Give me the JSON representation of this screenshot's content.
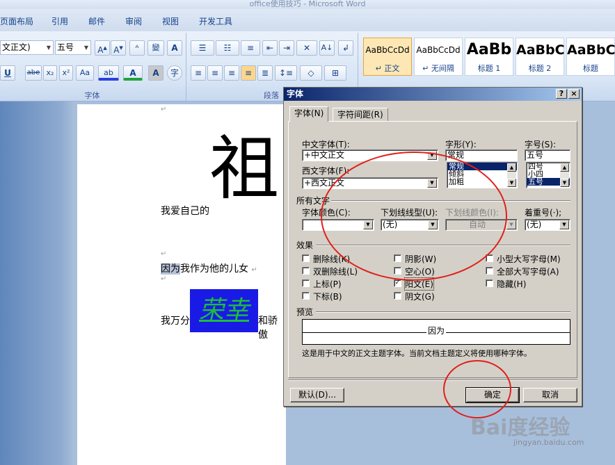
{
  "window": {
    "title": "office使用技巧 - Microsoft Word"
  },
  "ribbon": {
    "tabs": [
      "页面布局",
      "引用",
      "邮件",
      "审阅",
      "视图",
      "开发工具"
    ],
    "font_name": "文正文)",
    "font_size": "五号",
    "group_font": "字体",
    "group_paragraph": "段落",
    "styles": [
      {
        "sample": "AaBbCcDd",
        "caption": "↵ 正文"
      },
      {
        "sample": "AaBbCcDd",
        "caption": "↵ 无间隔"
      },
      {
        "sample": "AaBb",
        "caption": "标题 1"
      },
      {
        "sample": "AaBbC",
        "caption": "标题 2"
      },
      {
        "sample": "AaBbC",
        "caption": "标题"
      }
    ]
  },
  "document": {
    "big_char": "祖",
    "line1": "我爱自己的",
    "line2_highlight": "因为",
    "line2_rest": "我作为他的儿女",
    "line3_start": "我万分",
    "art_text": "荣幸",
    "line3_end": "和骄傲"
  },
  "dialog": {
    "title": "字体",
    "help": "?",
    "close": "×",
    "tabs": [
      "字体(N)",
      "字符间距(R)"
    ],
    "labels": {
      "cn_font": "中文字体(T):",
      "west_font": "西文字体(F):",
      "style": "字形(Y):",
      "size": "字号(S):",
      "all_text": "所有文字",
      "font_color": "字体颜色(C):",
      "underline": "下划线线型(U):",
      "underline_color": "下划线颜色(I):",
      "emphasis": "着重号(·);",
      "effects": "效果",
      "preview": "预览"
    },
    "values": {
      "cn_font": "+中文正文",
      "west_font": "+西文正文",
      "style": "常规",
      "size": "五号",
      "underline": "(无)",
      "underline_color": "自动",
      "emphasis": "(无)"
    },
    "style_list": [
      "常规",
      "倾斜",
      "加粗"
    ],
    "size_list": [
      "四号",
      "小四",
      "五号"
    ],
    "effects": [
      {
        "label": "删除线(K)",
        "checked": false
      },
      {
        "label": "双删除线(L)",
        "checked": false
      },
      {
        "label": "上标(P)",
        "checked": false
      },
      {
        "label": "下标(B)",
        "checked": false
      },
      {
        "label": "阴影(W)",
        "checked": false
      },
      {
        "label": "空心(O)",
        "checked": false
      },
      {
        "label": "阳文(E)",
        "checked": true
      },
      {
        "label": "阴文(G)",
        "checked": false
      },
      {
        "label": "小型大写字母(M)",
        "checked": false
      },
      {
        "label": "全部大写字母(A)",
        "checked": false
      },
      {
        "label": "隐藏(H)",
        "checked": false
      }
    ],
    "preview_text": "因为",
    "description": "这是用于中文的正文主题字体。当前文档主题定义将使用哪种字体。",
    "buttons": {
      "default": "默认(D)...",
      "ok": "确定",
      "cancel": "取消"
    }
  },
  "watermark": {
    "brand": "Bai度经验",
    "url": "jingyan.baidu.com"
  },
  "annotation_color": "#e0201a"
}
